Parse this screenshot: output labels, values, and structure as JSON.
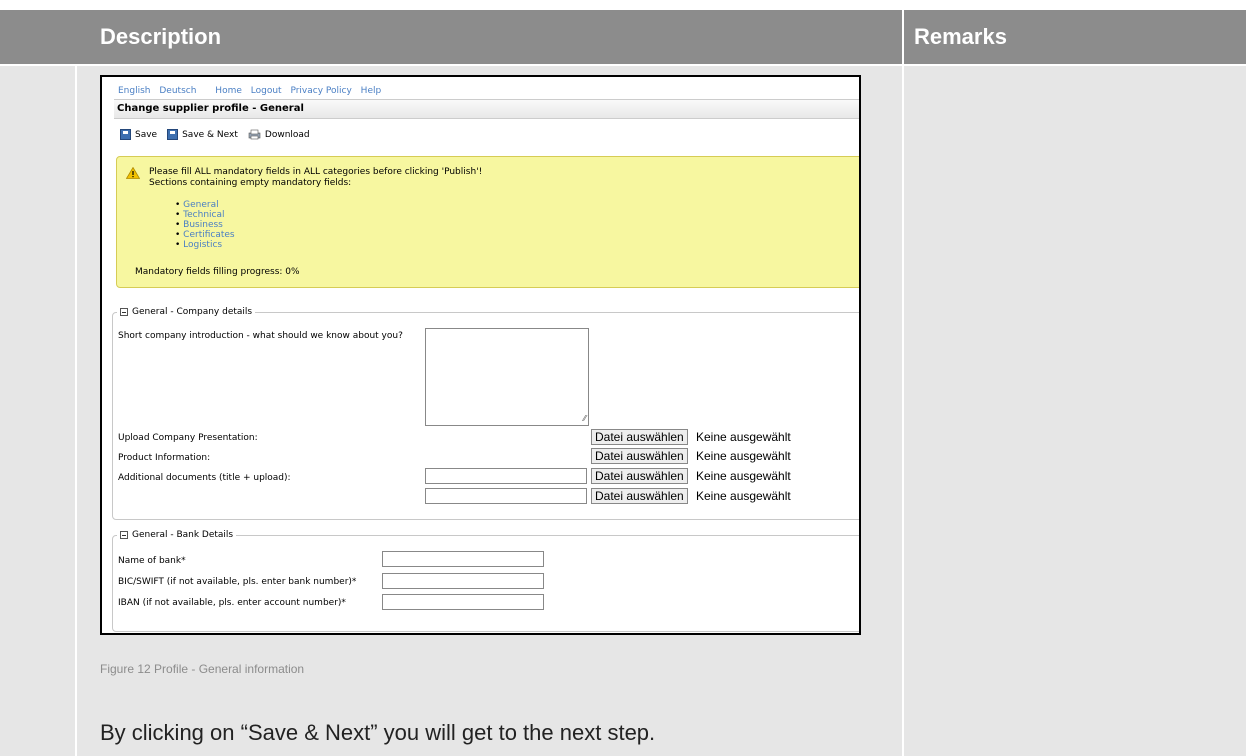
{
  "header": {
    "description": "Description",
    "remarks": "Remarks"
  },
  "screenshot": {
    "nav": {
      "english": "English",
      "deutsch": "Deutsch",
      "home": "Home",
      "logout": "Logout",
      "privacy": "Privacy Policy",
      "help": "Help"
    },
    "title": "Change supplier profile - General",
    "toolbar": {
      "save": "Save",
      "save_next": "Save & Next",
      "download": "Download"
    },
    "warning": {
      "line1": "Please fill ALL mandatory fields in ALL categories before clicking 'Publish'!",
      "line2": "Sections containing empty mandatory fields:",
      "sections": [
        "General",
        "Technical",
        "Business",
        "Certificates",
        "Logistics"
      ],
      "progress": "Mandatory fields filling progress: 0%"
    },
    "company": {
      "legend": "General - Company details",
      "intro_label": "Short company introduction - what should we know about you?",
      "upload_label": "Upload Company Presentation:",
      "product_label": "Product Information:",
      "additional_label": "Additional documents (title + upload):",
      "file_button": "Datei auswählen",
      "file_none": "Keine ausgewählt"
    },
    "bank": {
      "legend": "General - Bank Details",
      "name_label": "Name of bank*",
      "bic_label": "BIC/SWIFT (if not available, pls. enter bank number)*",
      "iban_label": "IBAN (if not available, pls. enter account number)*"
    }
  },
  "caption": "Figure 12 Profile - General information",
  "body_text": "By clicking on “Save & Next” you will get to the next step."
}
